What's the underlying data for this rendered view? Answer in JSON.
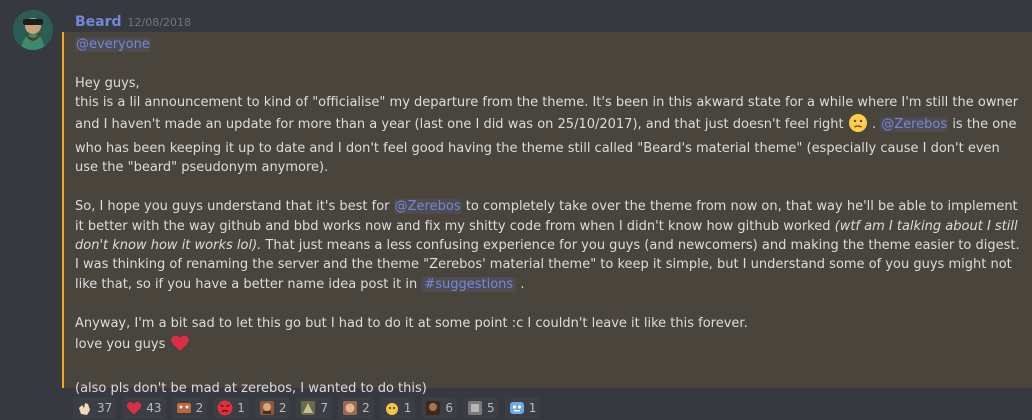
{
  "author": {
    "name": "Beard",
    "timestamp": "12/08/2018"
  },
  "message": {
    "mention_everyone": "@everyone",
    "greeting": "Hey guys,",
    "p1_a": "this is a lil announcement to kind of \"officialise\" my departure from the theme. It's been in this akward state for a while where I'm still the owner and I haven't made an update for more than a year (last one I did was on 25/10/2017), and that just doesn't feel right",
    "p1_b": ".",
    "mention_zerebos_1": "@Zerebos",
    "p1_c": "is the one who has been keeping it up to date and I don't feel good having the theme still called \"Beard's material theme\" (especially cause I don't even use the \"beard\" pseudonym anymore).",
    "p2_a": "So, I hope you guys understand that it's best for",
    "mention_zerebos_2": "@Zerebos",
    "p2_b": "to completely take over the theme from now on, that way he'll be able to implement it better with the way github and bbd works now and fix my shitty code from when I didn't know how github worked",
    "p2_italic": "(wtf am I talking about I still don't know how it works lol).",
    "p2_c": "That just means a less confusing experience for you guys (and newcomers) and making the theme easier to digest.",
    "p3_a": "I was thinking of renaming the server and the theme \"Zerebos' material theme\" to keep it simple, but I understand some of you guys might not like that, so if you have a better name idea post it in",
    "channel": "#suggestions",
    "p3_b": ".",
    "p4": "Anyway, I'm a bit sad to let this go but I had to do it at some point :c I couldn't leave it like this forever.",
    "p5": "love you guys",
    "p6": "(also pls don't be mad at zerebos, I wanted to do this)"
  },
  "reactions": [
    {
      "icon": "clap-icon",
      "count": "37"
    },
    {
      "icon": "heart-icon",
      "count": "43"
    },
    {
      "icon": "custom-emoji-1-icon",
      "count": "2"
    },
    {
      "icon": "angry-face-icon",
      "count": "1"
    },
    {
      "icon": "custom-emoji-2-icon",
      "count": "2"
    },
    {
      "icon": "custom-emoji-3-icon",
      "count": "7"
    },
    {
      "icon": "custom-emoji-4-icon",
      "count": "2"
    },
    {
      "icon": "custom-emoji-5-icon",
      "count": "1"
    },
    {
      "icon": "custom-emoji-6-icon",
      "count": "6"
    },
    {
      "icon": "custom-emoji-7-icon",
      "count": "5"
    },
    {
      "icon": "custom-emoji-8-icon",
      "count": "1"
    }
  ],
  "colors": {
    "accent": "#7289da",
    "highlight": "#49443c",
    "highlight_border": "#faa61a",
    "background": "#36393f"
  }
}
